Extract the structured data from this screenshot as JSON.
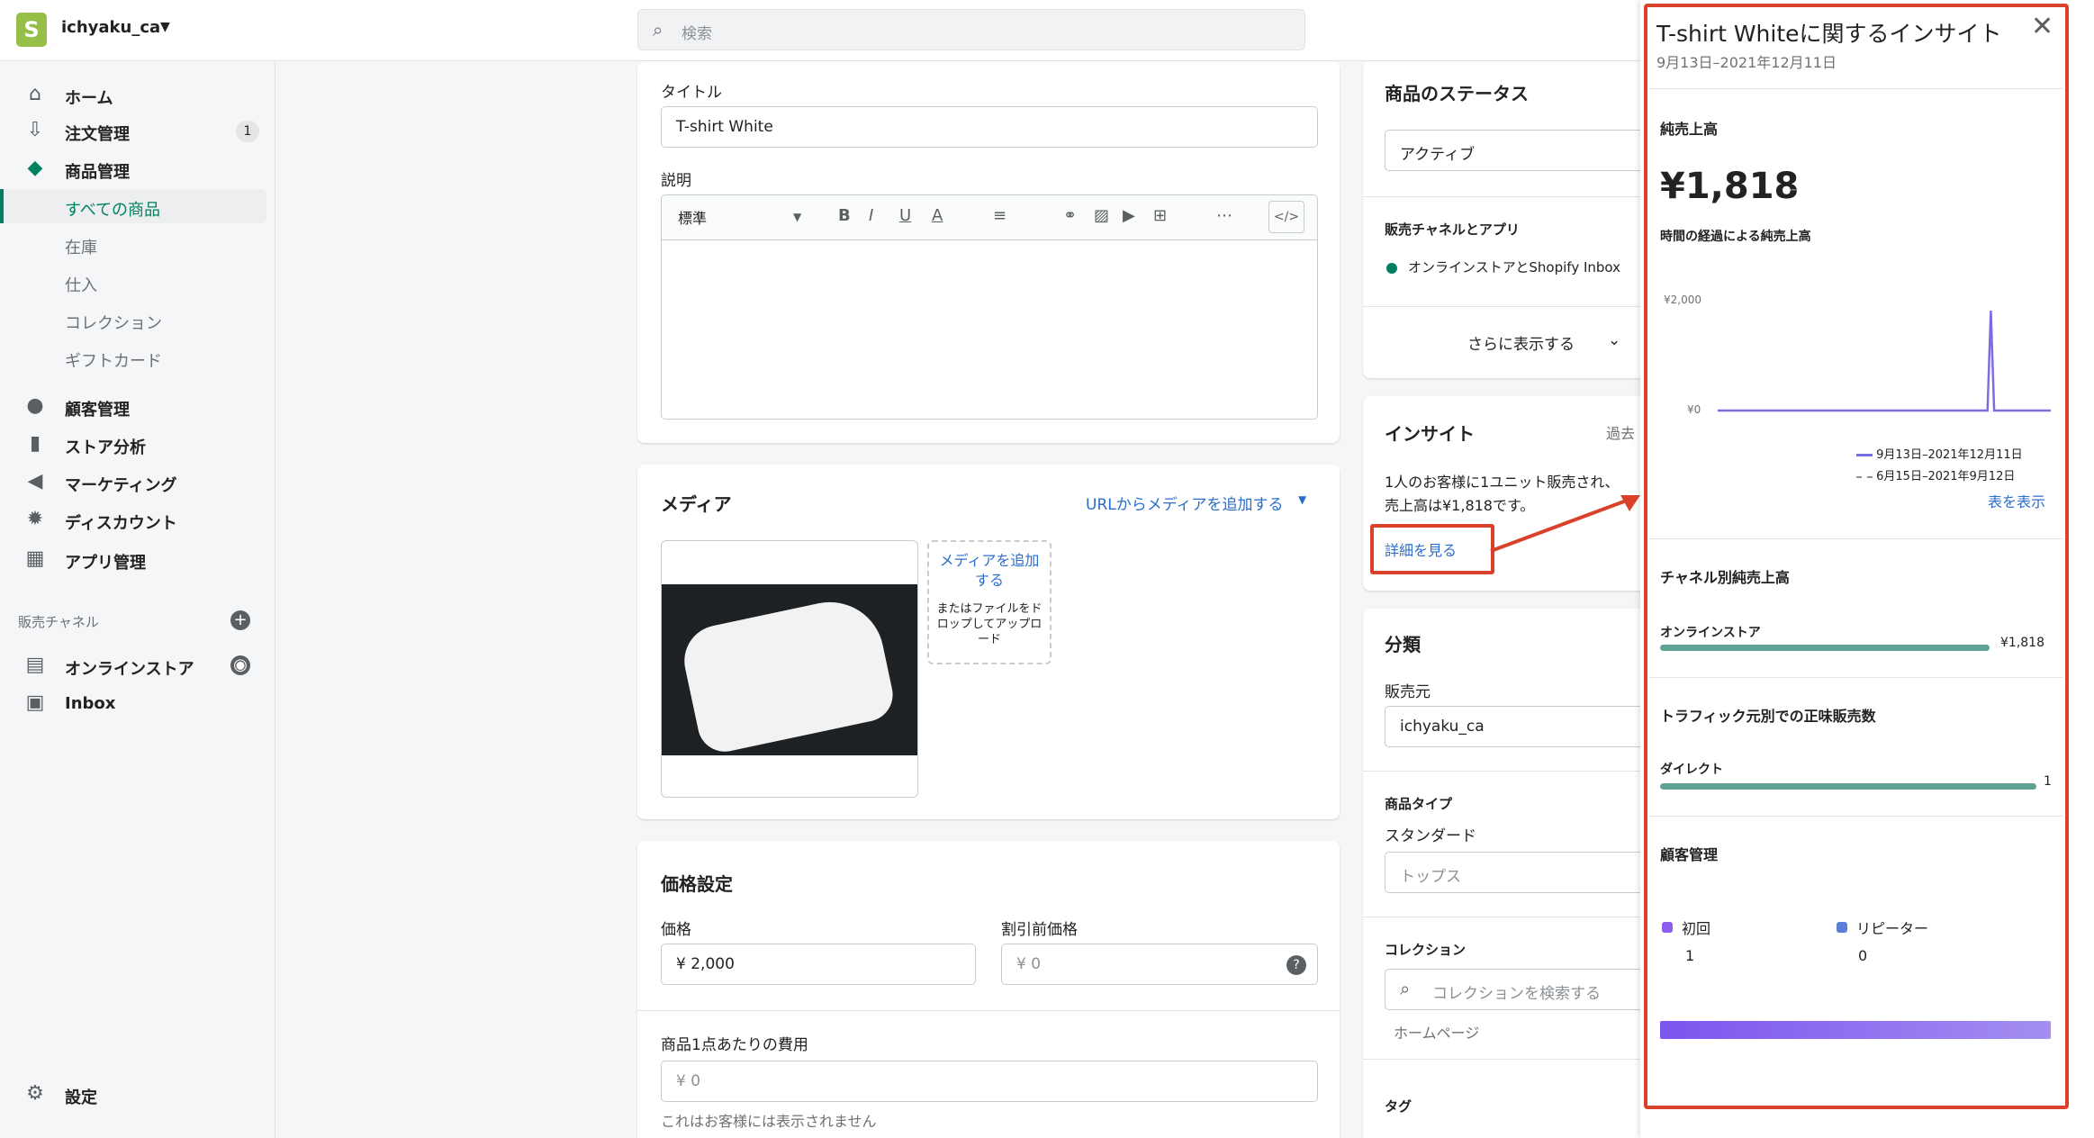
{
  "topbar": {
    "store_logo": "S",
    "store_name": "ichyaku_ca",
    "search_placeholder": "検索"
  },
  "sidebar": {
    "items": [
      {
        "label": "ホーム",
        "icon": "home-icon"
      },
      {
        "label": "注文管理",
        "icon": "orders-icon",
        "badge": "1"
      },
      {
        "label": "商品管理",
        "icon": "tag-icon"
      },
      {
        "label": "すべての商品"
      },
      {
        "label": "在庫"
      },
      {
        "label": "仕入"
      },
      {
        "label": "コレクション"
      },
      {
        "label": "ギフトカード"
      },
      {
        "label": "顧客管理",
        "icon": "person-icon"
      },
      {
        "label": "ストア分析",
        "icon": "analytics-icon"
      },
      {
        "label": "マーケティング",
        "icon": "megaphone-icon"
      },
      {
        "label": "ディスカウント",
        "icon": "discount-icon"
      },
      {
        "label": "アプリ管理",
        "icon": "apps-icon"
      }
    ],
    "channels_label": "販売チャネル",
    "channels": [
      {
        "label": "オンラインストア",
        "icon": "store-icon"
      },
      {
        "label": "Inbox",
        "icon": "inbox-icon"
      }
    ],
    "settings_label": "設定"
  },
  "product": {
    "title_label": "タイトル",
    "title_value": "T-shirt White",
    "description_label": "説明",
    "format_select": "標準",
    "toolbar": [
      "B",
      "I",
      "U",
      "A"
    ]
  },
  "media": {
    "heading": "メディア",
    "add_from_url": "URLからメディアを追加する",
    "add_media": "メディアを追加する",
    "drop_hint": "またはファイルをドロップしてアップロード"
  },
  "pricing": {
    "heading": "価格設定",
    "price_label": "価格",
    "price_value": "¥ 2,000",
    "compare_label": "割引前価格",
    "compare_value": "¥ 0",
    "cost_label": "商品1点あたりの費用",
    "cost_value": "¥ 0",
    "cost_hint": "これはお客様には表示されません"
  },
  "status": {
    "heading": "商品のステータス",
    "value": "アクティブ",
    "channels_label": "販売チャネルとアプリ",
    "channel_item": "オンラインストアとShopify Inbox",
    "show_more": "さらに表示する"
  },
  "insights": {
    "heading": "インサイト",
    "period_short": "過去",
    "summary_line1": "1人のお客様に1ユニット販売され、",
    "summary_line2": "売上高は¥1,818です。",
    "details_link": "詳細を見る"
  },
  "organization": {
    "heading": "分類",
    "vendor_label": "販売元",
    "vendor_value": "ichyaku_ca",
    "type_label": "商品タイプ",
    "type_sub": "スタンダード",
    "type_placeholder": "トップス",
    "collections_label": "コレクション",
    "collections_placeholder": "コレクションを検索する",
    "collection_item": "ホームページ",
    "tags_label": "タグ"
  },
  "panel": {
    "title": "T-shirt Whiteに関するインサイト",
    "date_range": "9月13日–2021年12月11日",
    "net_sales_label": "純売上高",
    "net_sales_value": "¥1,818",
    "net_sales_delta": "–",
    "over_time_label": "時間の経過による純売上高",
    "y_top": "¥2,000",
    "y_bottom": "¥0",
    "legend_current": "9月13日–2021年12月11日",
    "legend_previous": "6月15日–2021年9月12日",
    "view_table": "表を表示",
    "channel_heading": "チャネル別純売上高",
    "channel_name": "オンラインストア",
    "channel_value": "¥1,818",
    "traffic_heading": "トラフィック元別での正味販売数",
    "traffic_name": "ダイレクト",
    "traffic_value": "1",
    "customers_heading": "顧客管理",
    "first_time_label": "初回",
    "first_time_value": "1",
    "returning_label": "リピーター",
    "returning_value": "0",
    "colors": {
      "line": "#7b6fe0",
      "bar": "#5fa394",
      "first_time": "#8f5cf0",
      "returning": "#5a7fd6",
      "annotation": "#d9412b"
    }
  },
  "chart_data": {
    "type": "line",
    "title": "時間の経過による純売上高",
    "ylim": [
      0,
      2000
    ],
    "ytick_labels": [
      "¥2,000",
      "¥0"
    ],
    "series": [
      {
        "name": "9月13日–2021年12月11日",
        "spike_value": 1818,
        "baseline": 0
      },
      {
        "name": "6月15日–2021年9月12日",
        "values": []
      }
    ]
  }
}
